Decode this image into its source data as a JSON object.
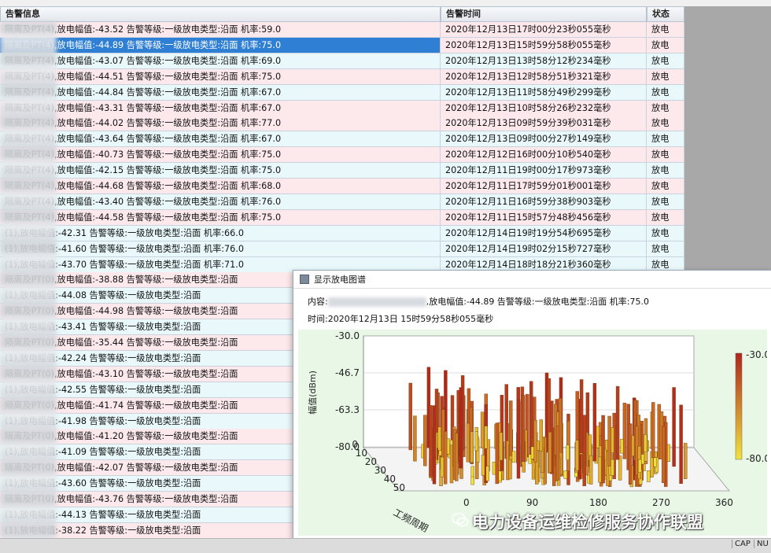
{
  "table": {
    "headers": [
      "告警信息",
      "告警时间",
      "状态"
    ],
    "rows": [
      {
        "info": "隔离及PT(4),放电幅值:-43.52 告警等级:一级放电类型:沿面 机率:59.0",
        "time": "2020年12月13日17时00分23秒055毫秒",
        "status": "放电"
      },
      {
        "info": "隔离及PT(4),放电幅值:-44.89 告警等级:一级放电类型:沿面 机率:75.0",
        "time": "2020年12月13日15时59分58秒055毫秒",
        "status": "放电"
      },
      {
        "info": "隔离及PT(4),放电幅值:-43.07 告警等级:一级放电类型:沿面 机率:69.0",
        "time": "2020年12月13日13时58分12秒234毫秒",
        "status": "放电"
      },
      {
        "info": "隔离及PT(4),放电幅值:-44.51 告警等级:一级放电类型:沿面 机率:75.0",
        "time": "2020年12月13日12时58分51秒321毫秒",
        "status": "放电"
      },
      {
        "info": "隔离及PT(4),放电幅值:-44.84 告警等级:一级放电类型:沿面 机率:67.0",
        "time": "2020年12月13日11时58分49秒299毫秒",
        "status": "放电"
      },
      {
        "info": "隔离及PT(4),放电幅值:-43.31 告警等级:一级放电类型:沿面 机率:67.0",
        "time": "2020年12月13日10时58分26秒232毫秒",
        "status": "放电"
      },
      {
        "info": "隔离及PT(4),放电幅值:-44.02 告警等级:一级放电类型:沿面 机率:77.0",
        "time": "2020年12月13日09时59分39秒031毫秒",
        "status": "放电"
      },
      {
        "info": "隔离及PT(4),放电幅值:-43.64 告警等级:一级放电类型:沿面 机率:67.0",
        "time": "2020年12月13日09时00分27秒149毫秒",
        "status": "放电"
      },
      {
        "info": "隔离及PT(4),放电幅值:-40.73 告警等级:一级放电类型:沿面 机率:75.0",
        "time": "2020年12月12日16时00分10秒540毫秒",
        "status": "放电"
      },
      {
        "info": "隔离及PT(4),放电幅值:-42.15 告警等级:一级放电类型:沿面 机率:75.0",
        "time": "2020年12月11日19时00分17秒973毫秒",
        "status": "放电"
      },
      {
        "info": "隔离及PT(4),放电幅值:-44.68 告警等级:一级放电类型:沿面 机率:68.0",
        "time": "2020年12月11日17时59分01秒001毫秒",
        "status": "放电"
      },
      {
        "info": "隔离及PT(4),放电幅值:-43.40 告警等级:一级放电类型:沿面 机率:76.0",
        "time": "2020年12月11日16时59分38秒903毫秒",
        "status": "放电"
      },
      {
        "info": "隔离及PT(4),放电幅值:-44.58 告警等级:一级放电类型:沿面 机率:75.0",
        "time": "2020年12月11日15时57分48秒456毫秒",
        "status": "放电"
      },
      {
        "info": "(1),放电幅值:-42.31 告警等级:一级放电类型:沿面 机率:66.0",
        "time": "2020年12月14日19时19分54秒695毫秒",
        "status": "放电"
      },
      {
        "info": "(1),放电幅值:-41.60 告警等级:一级放电类型:沿面 机率:76.0",
        "time": "2020年12月14日19时02分15秒727毫秒",
        "status": "放电"
      },
      {
        "info": "(1),放电幅值:-43.70 告警等级:一级放电类型:沿面 机率:71.0",
        "time": "2020年12月14日18时18分21秒360毫秒",
        "status": "放电"
      },
      {
        "info": "隔离及PT(0),放电幅值:-38.88 告警等级:一级放电类型:沿面",
        "time": "",
        "status": ""
      },
      {
        "info": "(1),放电幅值:-44.08 告警等级:一级放电类型:沿面",
        "time": "",
        "status": ""
      },
      {
        "info": "隔离及PT(0),放电幅值:-44.98 告警等级:一级放电类型:沿面",
        "time": "",
        "status": ""
      },
      {
        "info": "(1),放电幅值:-43.41 告警等级:一级放电类型:沿面",
        "time": "",
        "status": ""
      },
      {
        "info": "隔离及PT(0),放电幅值:-35.44 告警等级:一级放电类型:沿面",
        "time": "",
        "status": ""
      },
      {
        "info": "(1),放电幅值:-42.24 告警等级:一级放电类型:沿面",
        "time": "",
        "status": ""
      },
      {
        "info": "隔离及PT(0),放电幅值:-43.10 告警等级:一级放电类型:沿面",
        "time": "",
        "status": ""
      },
      {
        "info": "(1),放电幅值:-42.55 告警等级:一级放电类型:沿面",
        "time": "",
        "status": ""
      },
      {
        "info": "隔离及PT(0),放电幅值:-41.74 告警等级:一级放电类型:沿面",
        "time": "",
        "status": ""
      },
      {
        "info": "(1),放电幅值:-41.98 告警等级:一级放电类型:沿面",
        "time": "",
        "status": ""
      },
      {
        "info": "隔离及PT(0),放电幅值:-41.20 告警等级:一级放电类型:沿面",
        "time": "",
        "status": ""
      },
      {
        "info": "(1),放电幅值:-41.09 告警等级:一级放电类型:沿面",
        "time": "",
        "status": ""
      },
      {
        "info": "隔离及PT(0),放电幅值:-42.07 告警等级:一级放电类型:沿面",
        "time": "",
        "status": ""
      },
      {
        "info": "(1),放电幅值:-43.60 告警等级:一级放电类型:沿面",
        "time": "",
        "status": ""
      },
      {
        "info": "隔离及PT(0),放电幅值:-43.76 告警等级:一级放电类型:沿面",
        "time": "",
        "status": ""
      },
      {
        "info": "(1),放电幅值:-44.13 告警等级:一级放电类型:沿面",
        "time": "",
        "status": ""
      },
      {
        "info": "(1),放电幅值:-38.22 告警等级:一级放电类型:沿面",
        "time": "",
        "status": ""
      }
    ]
  },
  "popup": {
    "title": "显示放电图谱",
    "content_label": "内容:",
    "content_rest": ",放电幅值:-44.89 告警等级:一级放电类型:沿面 机率:75.0",
    "time_line": "时间:2020年12月13日 15时59分58秒055毫秒"
  },
  "chart_data": {
    "type": "bar3d",
    "ylabel": "幅值(dBm)",
    "xlabel": "工频周期",
    "z_ticks": [
      "-30.0",
      "-46.7",
      "-63.3",
      "-80.0"
    ],
    "x_ticks": [
      "0",
      "10",
      "20",
      "30",
      "40",
      "50"
    ],
    "phase_ticks": [
      "0",
      "90",
      "180",
      "270",
      "360"
    ],
    "colorbar_ticks": [
      "-30.0",
      "-80.0"
    ],
    "colors": {
      "low": "#f2e23a",
      "high": "#b0241a"
    }
  },
  "watermark": "电力设备运维检修服务协作联盟",
  "statusbar": {
    "cap": "CAP",
    "num": "NU"
  }
}
